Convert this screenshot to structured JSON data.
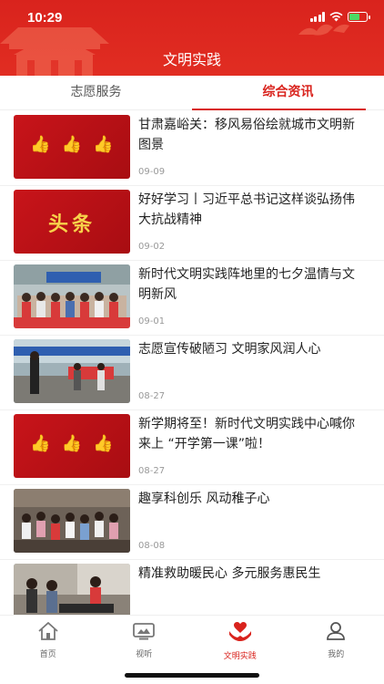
{
  "status_bar": {
    "time": "10:29"
  },
  "header": {
    "title": "文明实践"
  },
  "tabs": [
    {
      "label": "志愿服务",
      "active": false
    },
    {
      "label": "综合资讯",
      "active": true
    }
  ],
  "articles": [
    {
      "title": "甘肃嘉峪关：移风易俗绘就城市文明新图景",
      "date": "09-09",
      "thumb": "thumbs-up-banner"
    },
    {
      "title": "好好学习丨习近平总书记这样谈弘扬伟大抗战精神",
      "date": "09-02",
      "thumb": "toutiao-banner",
      "thumb_text": "头条"
    },
    {
      "title": "新时代文明实践阵地里的七夕温情与文明新风",
      "date": "09-01",
      "thumb": "group-photo"
    },
    {
      "title": "志愿宣传破陋习 文明家风润人心",
      "date": "08-27",
      "thumb": "outdoor-photo"
    },
    {
      "title": "新学期将至！新时代文明实践中心喊你来上 “开学第一课”啦！",
      "date": "08-27",
      "thumb": "thumbs-up-banner"
    },
    {
      "title": "趣享科创乐 风动稚子心",
      "date": "08-08",
      "thumb": "children-photo"
    },
    {
      "title": "精准救助暖民心 多元服务惠民生",
      "date": "",
      "thumb": "room-photo"
    }
  ],
  "bottom_nav": [
    {
      "label": "首页",
      "icon": "home-icon",
      "active": false
    },
    {
      "label": "视听",
      "icon": "tv-icon",
      "active": false
    },
    {
      "label": "文明实践",
      "icon": "heart-hands-icon",
      "active": true
    },
    {
      "label": "我的",
      "icon": "user-icon",
      "active": false
    }
  ],
  "colors": {
    "brand": "#d9231d",
    "accent_gold": "#f5c83a"
  }
}
